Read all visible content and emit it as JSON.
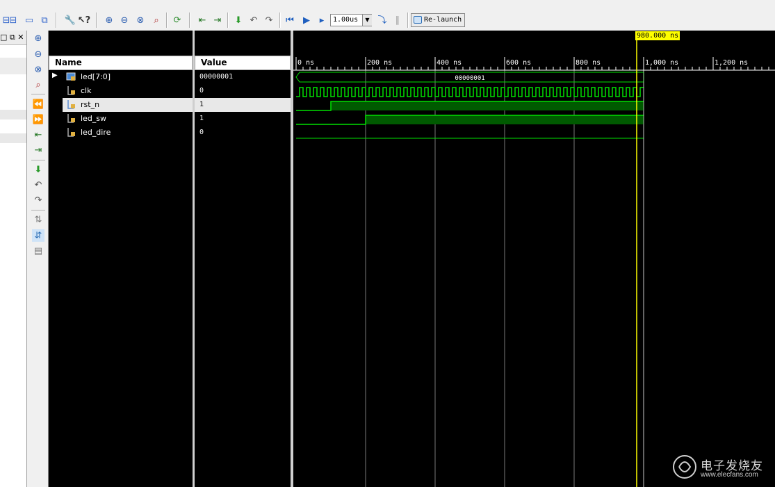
{
  "toolbar": {
    "time_value": "1.00us",
    "relaunch_label": "Re-launch"
  },
  "left_panel": {
    "header_glyphs": "□ ⧉ ✕"
  },
  "columns": {
    "name_header": "Name",
    "value_header": "Value"
  },
  "signals": [
    {
      "name": "led[7:0]",
      "value": "00000001",
      "type": "bus",
      "expandable": true
    },
    {
      "name": "clk",
      "value": "0",
      "type": "bit"
    },
    {
      "name": "rst_n",
      "value": "1",
      "type": "bit",
      "selected": true
    },
    {
      "name": "led_sw",
      "value": "1",
      "type": "bit"
    },
    {
      "name": "led_dire",
      "value": "0",
      "type": "bit"
    }
  ],
  "timeline": {
    "ticks": [
      "0 ns",
      "200 ns",
      "400 ns",
      "600 ns",
      "800 ns",
      "1,000 ns",
      "1,200 ns"
    ],
    "cursor_label": "980.000 ns",
    "cursor_ns": 980,
    "sim_end_ns": 1000,
    "bus_value_label": "00000001"
  },
  "waveforms": {
    "clk_period_ns": 20,
    "rst_n_rise_ns": 100,
    "led_sw_rise_ns": 200,
    "led_dire_constant": 0
  },
  "colors": {
    "wave": "#00e000",
    "wave_fill": "#005a00",
    "cursor": "#ffff00",
    "grid": "#ffffff",
    "undefined_line": "#00a000"
  },
  "watermark": {
    "text": "电子发烧友",
    "url": "www.elecfans.com"
  }
}
